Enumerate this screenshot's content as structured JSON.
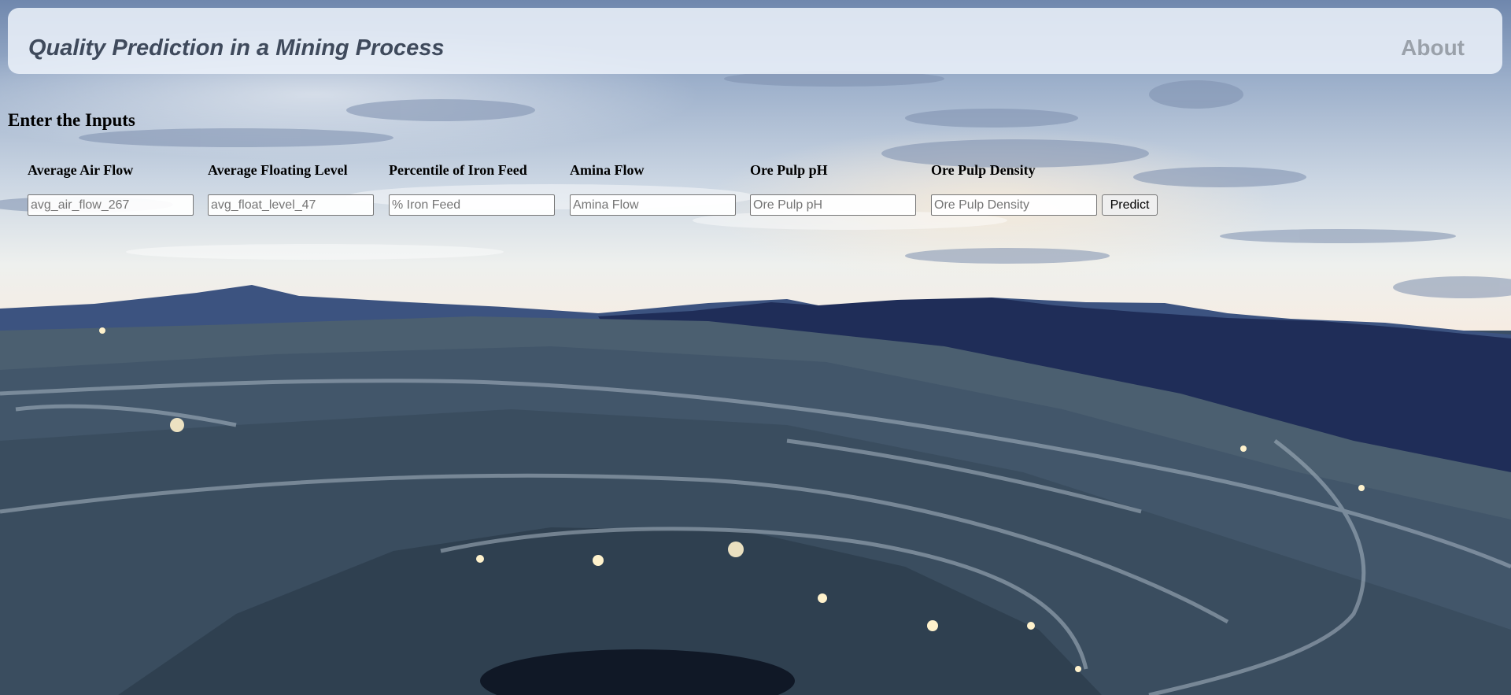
{
  "header": {
    "title": "Quality Prediction in a Mining Process",
    "about_label": "About"
  },
  "form": {
    "section_title": "Enter the Inputs",
    "fields": [
      {
        "label": "Average Air Flow",
        "placeholder": "avg_air_flow_267"
      },
      {
        "label": "Average Floating Level",
        "placeholder": "avg_float_level_47"
      },
      {
        "label": "Percentile of Iron Feed",
        "placeholder": "% Iron Feed"
      },
      {
        "label": "Amina Flow",
        "placeholder": "Amina Flow"
      },
      {
        "label": "Ore Pulp pH",
        "placeholder": "Ore Pulp pH"
      },
      {
        "label": "Ore Pulp Density",
        "placeholder": "Ore Pulp Density"
      }
    ],
    "submit_label": "Predict"
  },
  "background": {
    "scene": "open-pit-mine-at-dusk",
    "colors": {
      "sky_top": "#6f87ad",
      "horizon": "#f6ece2",
      "mountains": "#1f2d58",
      "pit": "#3b4f5f"
    }
  }
}
